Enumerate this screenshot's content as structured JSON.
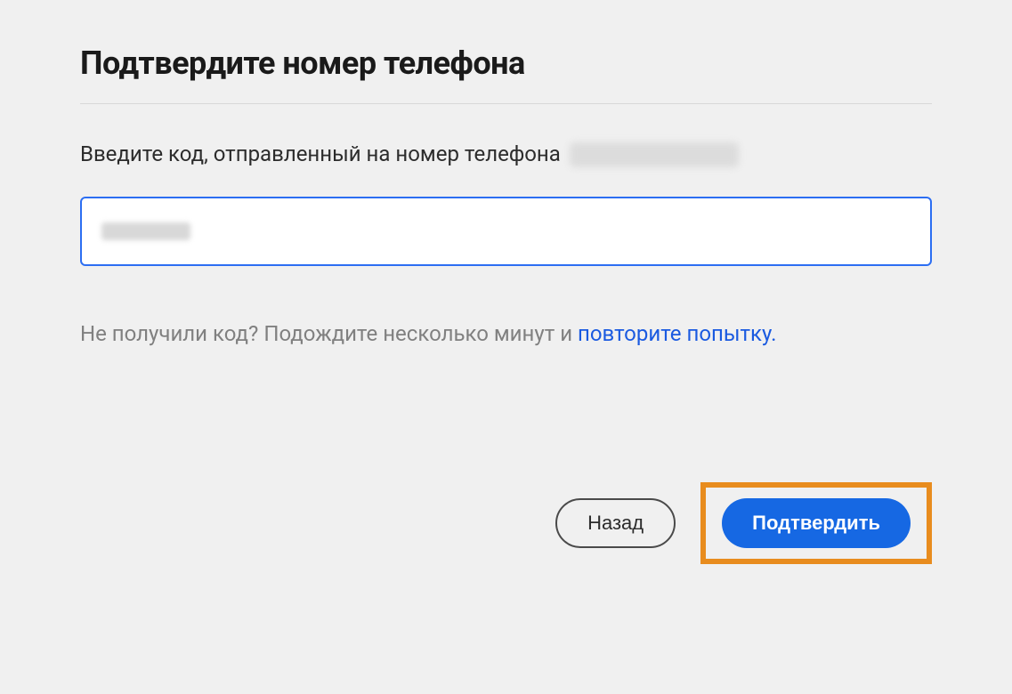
{
  "heading": "Подтвердите номер телефона",
  "instruction": "Введите код, отправленный на номер телефона",
  "code_input": {
    "value": "",
    "placeholder": ""
  },
  "resend": {
    "prefix": "Не получили код? Подождите несколько минут и ",
    "link_text": "повторите попытку."
  },
  "buttons": {
    "back": "Назад",
    "confirm": "Подтвердить"
  }
}
